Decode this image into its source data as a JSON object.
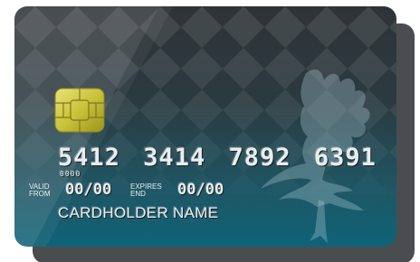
{
  "card": {
    "number": "5412 3414 7892 6391",
    "small_digits": "0000",
    "valid_from_label_line1": "VALID",
    "valid_from_label_line2": "FROM",
    "valid_from": "00/00",
    "expires_label_line1": "EXPIRES",
    "expires_label_line2": "END",
    "expires_end": "00/00",
    "cardholder_name": "CARDHOLDER NAME"
  },
  "colors": {
    "card_top": "#2f3337",
    "card_bottom": "#0f6378",
    "shadow": "#4a4d4f",
    "chip_gold": "#c9c23a",
    "emboss_text": "#e8eef0"
  },
  "icons": {
    "chip": "emv-chip-icon",
    "bird": "eagle-silhouette-icon"
  }
}
